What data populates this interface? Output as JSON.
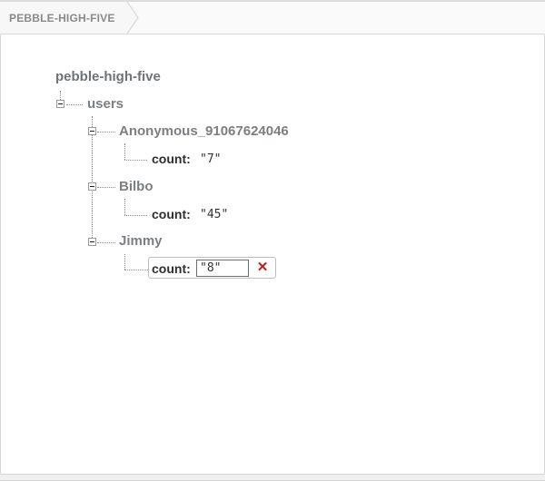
{
  "breadcrumb": {
    "label": "PEBBLE-HIGH-FIVE"
  },
  "tree": {
    "root": "pebble-high-five",
    "users_label": "users",
    "children": [
      {
        "name": "Anonymous_91067624046",
        "key": "count:",
        "value": "\"7\""
      },
      {
        "name": "Bilbo",
        "key": "count:",
        "value": "\"45\""
      },
      {
        "name": "Jimmy",
        "key": "count:",
        "value": "\"8\"",
        "editing": true
      }
    ]
  },
  "delete_icon": "✕",
  "colors": {
    "delete": "#c21b1b",
    "node_label": "#7b7f82"
  }
}
